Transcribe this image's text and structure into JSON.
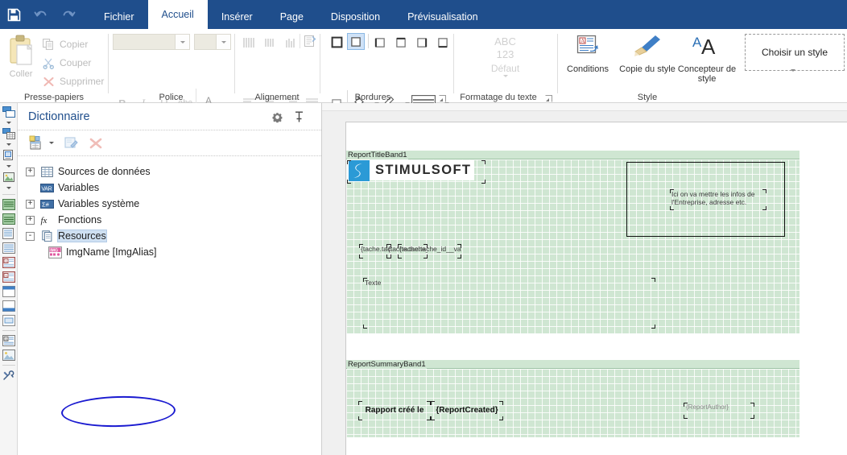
{
  "menubar": {
    "quick_actions": [
      {
        "name": "save-icon",
        "label": "Enregistrer"
      },
      {
        "name": "undo-icon",
        "label": "Annuler"
      },
      {
        "name": "redo-icon",
        "label": "Rétablir"
      }
    ],
    "tabs": [
      {
        "label": "Fichier",
        "active": false
      },
      {
        "label": "Accueil",
        "active": true
      },
      {
        "label": "Insérer",
        "active": false
      },
      {
        "label": "Page",
        "active": false
      },
      {
        "label": "Disposition",
        "active": false
      },
      {
        "label": "Prévisualisation",
        "active": false
      }
    ],
    "background": "#1f4e8c"
  },
  "ribbon": {
    "clipboard": {
      "group_label": "Presse-papiers",
      "paste_label": "Coller",
      "items": [
        {
          "label": "Copier",
          "icon": "copy-icon"
        },
        {
          "label": "Couper",
          "icon": "scissors-icon"
        },
        {
          "label": "Supprimer",
          "icon": "delete-x-icon"
        }
      ]
    },
    "font": {
      "group_label": "Police",
      "family_value": "",
      "size_value": "",
      "bold_label": "B",
      "italic_label": "I",
      "underline_label": "U",
      "strike_label": "abc",
      "text_color_label": "A"
    },
    "alignment": {
      "group_label": "Alignement"
    },
    "borders": {
      "group_label": "Bordures"
    },
    "text_format": {
      "group_label": "Formatage du texte",
      "line1": "ABC",
      "line2": "123",
      "line3": "Défaut"
    },
    "style": {
      "group_label": "Style",
      "buttons": [
        {
          "label": "Conditions",
          "icon": "conditions-icon"
        },
        {
          "label": "Copie du style",
          "icon": "format-painter-icon"
        },
        {
          "label": "Concepteur de style",
          "icon": "style-designer-icon"
        }
      ],
      "picker_label": "Choisir un style"
    }
  },
  "vertical_toolbar": {
    "items": [
      {
        "icon": "data-band-icon",
        "has_arrow": true
      },
      {
        "icon": "data-table-icon",
        "has_arrow": true
      },
      {
        "icon": "panel-icon",
        "has_arrow": true
      },
      {
        "icon": "image-band-icon",
        "has_arrow": true
      },
      {
        "icon": "header-band-icon",
        "has_arrow": false
      },
      {
        "icon": "footer-band-icon",
        "has_arrow": false
      },
      {
        "icon": "page-header-icon",
        "has_arrow": false
      },
      {
        "icon": "page-footer-icon",
        "has_arrow": false
      },
      {
        "icon": "report-title-icon",
        "has_arrow": false
      },
      {
        "icon": "report-summary-icon",
        "has_arrow": false
      },
      {
        "icon": "column-header-icon",
        "has_arrow": false
      },
      {
        "icon": "column-footer-icon",
        "has_arrow": false
      },
      {
        "icon": "child-band-icon",
        "has_arrow": false
      },
      {
        "icon": "text-component-icon",
        "has_arrow": false
      },
      {
        "icon": "image-component-icon",
        "has_arrow": false
      },
      {
        "icon": "tools-icon",
        "has_arrow": false
      }
    ]
  },
  "dictionary": {
    "title": "Dictionnaire",
    "header_buttons": [
      {
        "name": "gear-icon",
        "label": "Options"
      },
      {
        "name": "pin-icon",
        "label": "Épingler"
      }
    ],
    "toolbar_buttons": [
      {
        "name": "new-item-icon",
        "label": "Nouvel élément"
      },
      {
        "name": "edit-icon",
        "label": "Éditer"
      },
      {
        "name": "delete-x-icon",
        "label": "Supprimer"
      }
    ],
    "tree": [
      {
        "label": "Sources de données",
        "icon": "datasource-icon",
        "expander": "+",
        "level": 0,
        "selected": false
      },
      {
        "label": "Variables",
        "icon": "var-icon",
        "expander": "",
        "level": 0,
        "selected": false
      },
      {
        "label": "Variables système",
        "icon": "sysvar-icon",
        "expander": "+",
        "level": 0,
        "selected": false
      },
      {
        "label": "Fonctions",
        "icon": "fx-icon",
        "expander": "+",
        "level": 0,
        "selected": false
      },
      {
        "label": "Resources",
        "icon": "resource-icon",
        "expander": "-",
        "level": 0,
        "selected": true
      },
      {
        "label": "ImgName [ImgAlias]",
        "icon": "img-resource-icon",
        "expander": "",
        "level": 1,
        "selected": false
      }
    ],
    "annotation": {
      "shape": "ellipse",
      "color": "#1a1ad0",
      "target": "ImgName [ImgAlias]"
    }
  },
  "canvas": {
    "bands": [
      {
        "name": "ReportTitleBand1",
        "label": "ReportTitleBand1"
      },
      {
        "name": "ReportSummaryBand1",
        "label": "ReportSummaryBand1"
      }
    ],
    "components": {
      "logo": {
        "word": "STIMULSOFT",
        "accent": "#2b9ad6"
      },
      "company_info": "Ici on va mettre les infos de l'Entreprise, adresse etc.",
      "field_1": "{tache.tac",
      "field_2": "{tache.tache_id}",
      "field_3": "{tache.tache_id__valeur}",
      "text_placeholder": "Texte",
      "summary_label": "Rapport créé le",
      "summary_created": "{ReportCreated}",
      "summary_author": "{ReportAuthor}"
    }
  }
}
